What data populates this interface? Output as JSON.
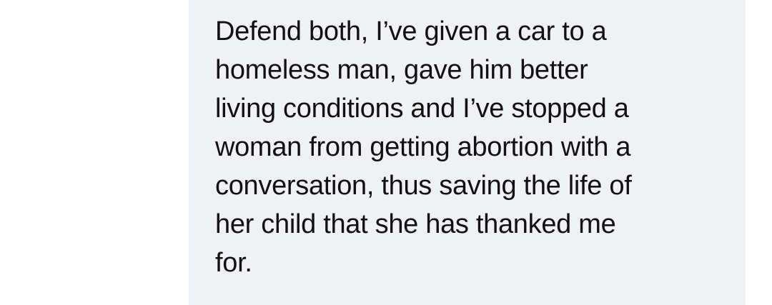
{
  "message": {
    "lines": [
      "Defend both, I’ve given a car to a",
      "homeless man, gave him better",
      "living conditions and I’ve stopped a",
      "woman from getting abortion with a",
      "conversation, thus saving the life of",
      "her child that she has thanked me",
      "for."
    ],
    "bubble_color": "#f0f1f4"
  }
}
